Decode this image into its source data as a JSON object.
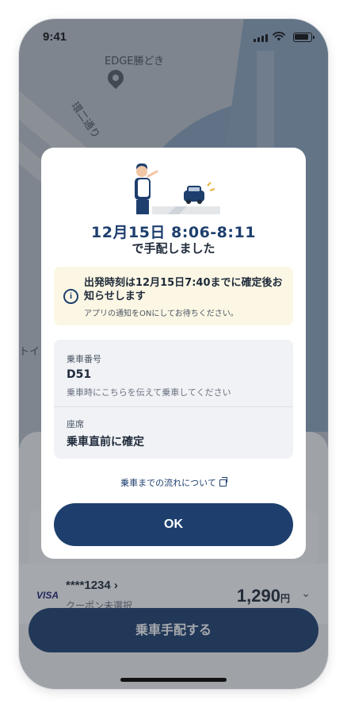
{
  "status_bar": {
    "time": "9:41"
  },
  "map": {
    "place_name": "EDGE勝どき",
    "road_name": "環二通り",
    "edge_text": "トイ"
  },
  "modal": {
    "headline": "12月15日 8:06-8:11",
    "subline": "で手配しました",
    "notice": {
      "icon": "info-icon",
      "title": "出発時刻は12月15日7:40までに確定後お知らせします",
      "subtitle": "アプリの通知をONにしてお待ちください。"
    },
    "boarding_number": {
      "label": "乗車番号",
      "value": "D51",
      "note": "乗車時にこちらを伝えて乗車してください"
    },
    "seat": {
      "label": "座席",
      "value": "乗車直前に確定"
    },
    "flow_link": "乗車までの流れについて",
    "ok_label": "OK"
  },
  "payment": {
    "brand": "VISA",
    "card_number": "****1234",
    "card_chevron": "›",
    "coupon": "クーポン未選択",
    "price": "1,290",
    "currency": "円",
    "price_chevron": "⌄"
  },
  "book_button": "乗車手配する",
  "colors": {
    "primary": "#1e3f6e",
    "notice_bg": "#fbf7e4",
    "info_bg": "#f0f2f5"
  }
}
